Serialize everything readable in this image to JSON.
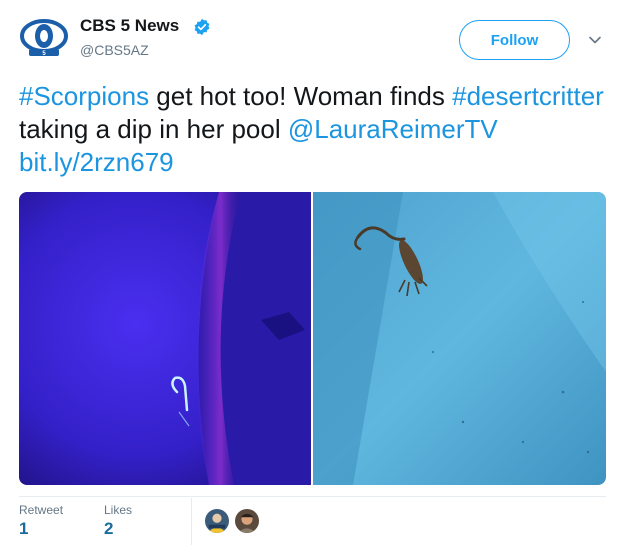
{
  "header": {
    "display_name": "CBS 5 News",
    "handle": "@CBS5AZ",
    "follow_label": "Follow",
    "avatar_label": "5"
  },
  "tweet": {
    "hashtag_1": "#Scorpions",
    "text_1": " get hot too! Woman finds ",
    "hashtag_2": "#desertcritter",
    "text_2": " taking a dip in her pool ",
    "mention": "@LauraReimerTV",
    "text_3": " ",
    "link": "bit.ly/2rzn679"
  },
  "stats": {
    "retweet_label": "Retweet",
    "retweet_count": "1",
    "likes_label": "Likes",
    "likes_count": "2"
  },
  "icons": {
    "verified": "verified-badge-icon",
    "caret": "chevron-down-icon"
  },
  "colors": {
    "accent": "#1da1f2",
    "link": "#1b95e0",
    "stat_value": "#1b6c9c"
  }
}
